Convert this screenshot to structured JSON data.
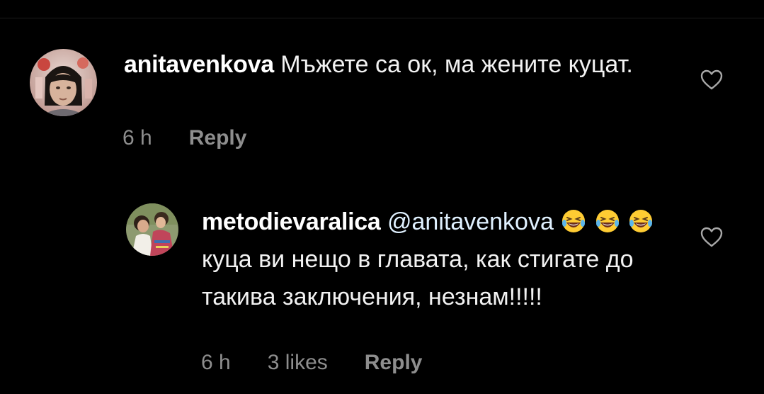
{
  "comments": [
    {
      "username": "anitavenkova",
      "text": "Мъжете са ок, ма жените куцат.",
      "time": "6 h",
      "reply_label": "Reply",
      "avatar_icon": "profile-photo-woman"
    },
    {
      "username": "metodievaralica",
      "mention": "@anitavenkova",
      "text": "куца ви нещо в главата, как стигате до такива заключения, незнам!!!!!",
      "time": "6 h",
      "likes": "3 likes",
      "reply_label": "Reply",
      "emoji": "laughing-tears-emoji",
      "avatar_icon": "profile-photo-two-people"
    }
  ],
  "icons": {
    "like": "heart-outline-icon"
  },
  "colors": {
    "background": "#000000",
    "text": "#f2f2f2",
    "meta": "#8e8e8e",
    "mention": "#e0f1ff"
  }
}
